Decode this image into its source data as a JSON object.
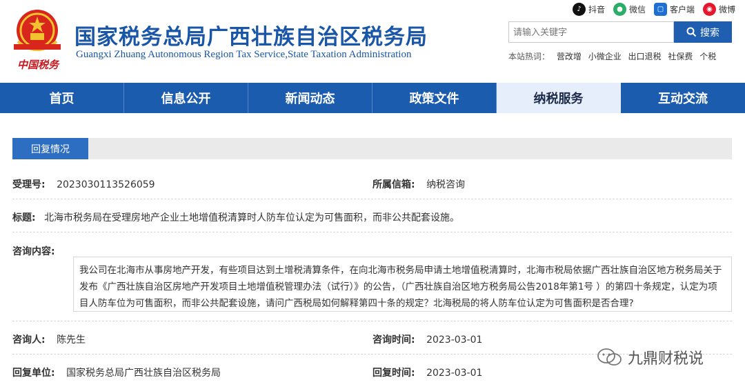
{
  "header": {
    "title": "国家税务总局广西壮族自治区税务局",
    "subtitle": "Guangxi Zhuang Autonomous Region Tax Service,State Taxation Administration",
    "emblem_text": "中国税务",
    "social": [
      {
        "label": "抖音",
        "icon": "douyin-icon",
        "color": "#111111"
      },
      {
        "label": "微信",
        "icon": "wechat-icon",
        "color": "#2aae67"
      },
      {
        "label": "客户端",
        "icon": "app-client-icon",
        "color": "#1f6fd1"
      },
      {
        "label": "微博",
        "icon": "weibo-icon",
        "color": "#e6162d"
      }
    ],
    "search": {
      "placeholder": "请输入关键字",
      "button_label": "搜索"
    },
    "hot_label": "本站热词：",
    "hot_words": [
      "营改增",
      "小微企业",
      "出口退税",
      "社保费",
      "个税"
    ]
  },
  "nav": {
    "items": [
      "首页",
      "信息公开",
      "新闻动态",
      "政策文件",
      "纳税服务",
      "互动交流"
    ],
    "active_index": 4
  },
  "section": {
    "tab": "回复情况"
  },
  "detail": {
    "accept_no_label": "受理号:",
    "accept_no": "2023030113526059",
    "mailbox_label": "所属信箱:",
    "mailbox": "纳税咨询",
    "subject_label": "标题:",
    "subject": "北海市税务局在受理房地产企业土地增值税清算时人防车位认定为可售面积，而非公共配套设施。",
    "content_label": "咨询内容:",
    "content": "我公司在北海市从事房地产开发，有些项目达到土增税清算条件，在向北海市税务局申请土地增值税清算时，北海市税局依据广西壮族自治区地方税务局关于发布《广西壮族自治区房地产开发项目土地增值税管理办法（试行）》的公告，（广西壮族自治区地方税务局公告2018年第1号 ）的第四十条规定，认定为项目人防车位为可售面积，而非公共配套设施，请问广西税局如何解释第四十条的规定？北海税局的将人防车位认定为可售面积是否合理?",
    "asker_label": "咨询人:",
    "asker": "陈先生",
    "ask_time_label": "咨询时间:",
    "ask_time": "2023-03-01",
    "reply_unit_label": "回复单位:",
    "reply_unit": "国家税务总局广西壮族自治区税务局",
    "reply_time_label": "回复时间:",
    "reply_time": "2023-03-01"
  },
  "watermark": "九鼎财税说"
}
